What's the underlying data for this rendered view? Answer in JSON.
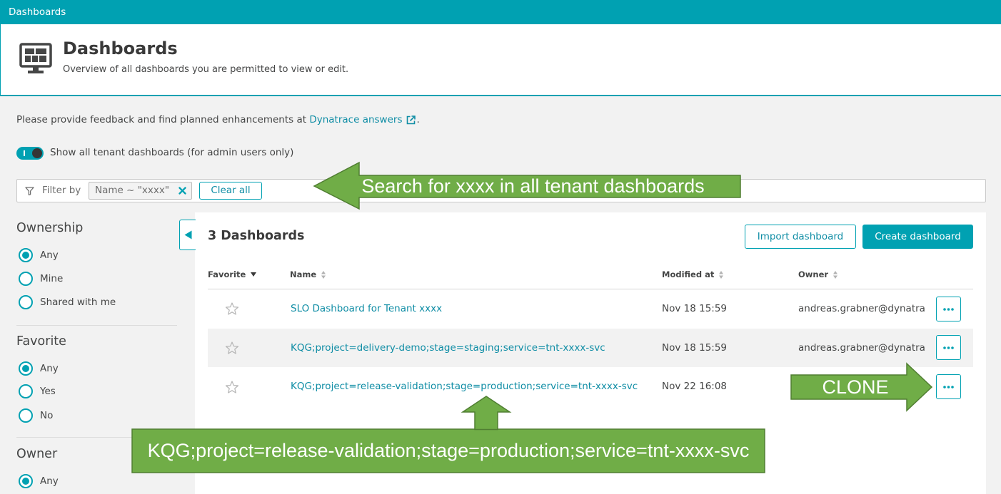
{
  "topbar": {
    "title": "Dashboards"
  },
  "header": {
    "icon": "dashboard-monitor-icon",
    "title": "Dashboards",
    "subtitle": "Overview of all dashboards you are permitted to view or edit."
  },
  "feedback": {
    "prefix": "Please provide feedback and find planned enhancements at ",
    "link_label": "Dynatrace answers",
    "link_icon": "external-link-icon",
    "suffix": "."
  },
  "tenant_toggle": {
    "on": true,
    "label": "Show all tenant dashboards (for admin users only)"
  },
  "filter": {
    "icon": "filter-funnel-icon",
    "label": "Filter by",
    "chips": [
      {
        "text": "Name ~ \"xxxx\"",
        "remove_icon": "close-icon"
      }
    ],
    "clear_label": "Clear all"
  },
  "sidebar": {
    "groups": [
      {
        "title": "Ownership",
        "options": [
          {
            "label": "Any",
            "selected": true
          },
          {
            "label": "Mine",
            "selected": false
          },
          {
            "label": "Shared with me",
            "selected": false
          }
        ]
      },
      {
        "title": "Favorite",
        "options": [
          {
            "label": "Any",
            "selected": true
          },
          {
            "label": "Yes",
            "selected": false
          },
          {
            "label": "No",
            "selected": false
          }
        ]
      },
      {
        "title": "Owner",
        "options": [
          {
            "label": "Any",
            "selected": true
          }
        ]
      }
    ],
    "collapse_icon": "collapse-left-icon"
  },
  "main": {
    "count_title": "3 Dashboards",
    "import_label": "Import dashboard",
    "create_label": "Create dashboard",
    "columns": [
      {
        "label": "Favorite",
        "sort_icon": "sort-descending-icon"
      },
      {
        "label": "Name",
        "sort_icon": "sort-icon"
      },
      {
        "label": "Modified at",
        "sort_icon": "sort-icon"
      },
      {
        "label": "Owner",
        "sort_icon": "sort-icon"
      }
    ],
    "rows": [
      {
        "favorite": false,
        "name": "SLO Dashboard for Tenant xxxx",
        "modified": "Nov 18 15:59",
        "owner": "andreas.grabner@dynatra"
      },
      {
        "favorite": false,
        "name": "KQG;project=delivery-demo;stage=staging;service=tnt-xxxx-svc",
        "modified": "Nov 18 15:59",
        "owner": "andreas.grabner@dynatra"
      },
      {
        "favorite": false,
        "name": "KQG;project=release-validation;stage=production;service=tnt-xxxx-svc",
        "modified": "Nov 22 16:08"
      }
    ],
    "row_star_icon": "star-outline-icon",
    "row_menu_icon": "more-options-icon"
  },
  "annotations": {
    "search_callout": "Search for xxxx in all tenant dashboards",
    "clone_callout": "CLONE",
    "name_callout": "KQG;project=release-validation;stage=production;service=tnt-xxxx-svc",
    "fill_color": "#70ad47",
    "border_color": "#507e32"
  },
  "colors": {
    "accent": "#00a1b2",
    "link": "#0f8da5",
    "text": "#454646",
    "page_bg": "#f2f2f2"
  }
}
